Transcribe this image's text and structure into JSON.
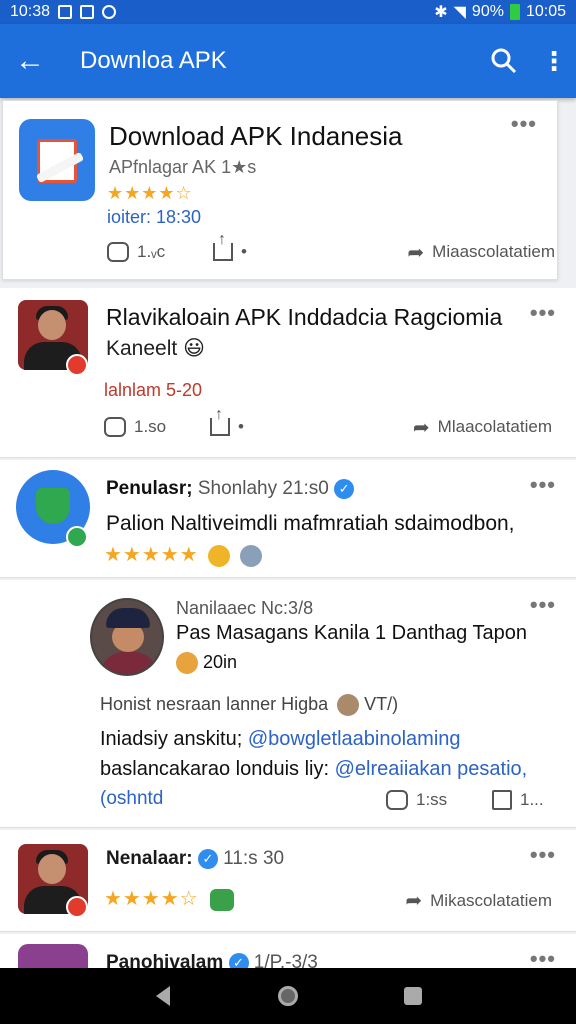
{
  "status_bar": {
    "time_left": "10:38",
    "battery": "90%",
    "time_right": "10:05"
  },
  "app_bar": {
    "title": "Downloa APK"
  },
  "cards": [
    {
      "title": "Download APK Indanesia",
      "subtitle": "APfnlagar AK 1★s",
      "rating_stars": "★★★★☆",
      "date": "ioiter: 18:30",
      "comments": "1.ᵥc",
      "share": "",
      "recommend": "Miaascolatatiem"
    },
    {
      "title": "Rlavikaloain APK Inddadcia Ragciomia",
      "subtitle": "Kaneelt",
      "date": "lalnlam 5-20",
      "comments": "1.so",
      "recommend": "Mlaacolatatiem"
    },
    {
      "name": "Penulasr;",
      "meta": "Shonlahy 21:s0",
      "text": "Palion Naltiveimdli mafmratiah sdaimodbon,",
      "rating_stars": "★★★★★"
    },
    {
      "name": "Nanilaaec Nc:3/8",
      "title": "Pas Masagans Kanila 1 Danthag Tapon",
      "time": "20in",
      "line1": "Honist nesraan lanner Higba",
      "line1_suffix": "VT/)",
      "line2": "Iniadsiy anskitu;",
      "line2_link": "@bowgletlaabinolaming",
      "line3": "baslancakarao londuis liy:",
      "line3_link": "@elreaiiakan pesatio,",
      "line4": "(oshntd",
      "comments": "1:ss",
      "edit": "1..."
    },
    {
      "name": "Nenalaar:",
      "time": "11:s 30",
      "rating_stars": "★★★★☆",
      "recommend": "Mikascolatatiem"
    },
    {
      "name": "Panohivalam",
      "time": "1/P.-3/3"
    }
  ]
}
